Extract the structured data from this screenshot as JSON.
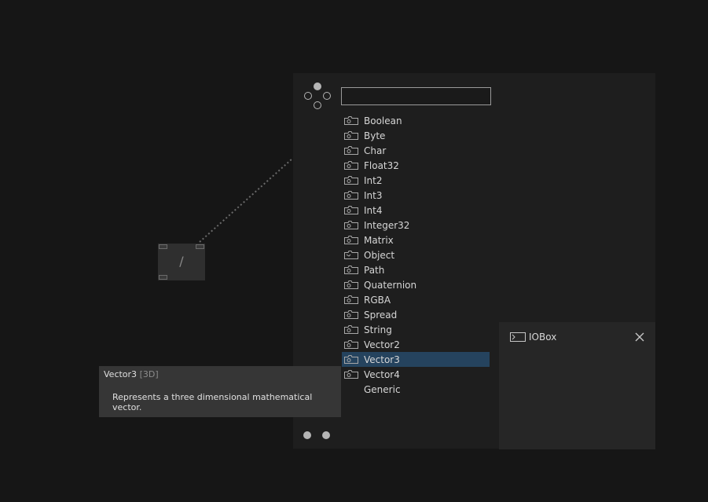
{
  "search": {
    "value": ""
  },
  "node": {
    "symbol": "/"
  },
  "list": {
    "items": [
      {
        "label": "Boolean",
        "icon": "io-icon"
      },
      {
        "label": "Byte",
        "icon": "io-icon"
      },
      {
        "label": "Char",
        "icon": "io-icon"
      },
      {
        "label": "Float32",
        "icon": "io-icon"
      },
      {
        "label": "Int2",
        "icon": "io-icon"
      },
      {
        "label": "Int3",
        "icon": "io-icon"
      },
      {
        "label": "Int4",
        "icon": "io-icon"
      },
      {
        "label": "Integer32",
        "icon": "io-icon"
      },
      {
        "label": "Matrix",
        "icon": "io-icon"
      },
      {
        "label": "Object",
        "icon": "object-icon"
      },
      {
        "label": "Path",
        "icon": "io-icon"
      },
      {
        "label": "Quaternion",
        "icon": "io-icon"
      },
      {
        "label": "RGBA",
        "icon": "io-icon"
      },
      {
        "label": "Spread",
        "icon": "io-icon"
      },
      {
        "label": "String",
        "icon": "io-icon"
      },
      {
        "label": "Vector2",
        "icon": "io-icon"
      },
      {
        "label": "Vector3",
        "icon": "io-icon",
        "selected": true
      },
      {
        "label": "Vector4",
        "icon": "io-icon"
      },
      {
        "label": "Generic",
        "icon": "none"
      }
    ]
  },
  "detail": {
    "title": "IOBox",
    "icon": "terminal-icon",
    "close_icon": "close-icon"
  },
  "tooltip": {
    "name": "Vector3",
    "tag": "[3D]",
    "description": "Represents a three dimensional mathematical vector.",
    "trailing": "."
  },
  "colors": {
    "background": "#161616",
    "panel": "#1e1e1e",
    "selected": "#25435e",
    "tooltip": "#363636"
  }
}
